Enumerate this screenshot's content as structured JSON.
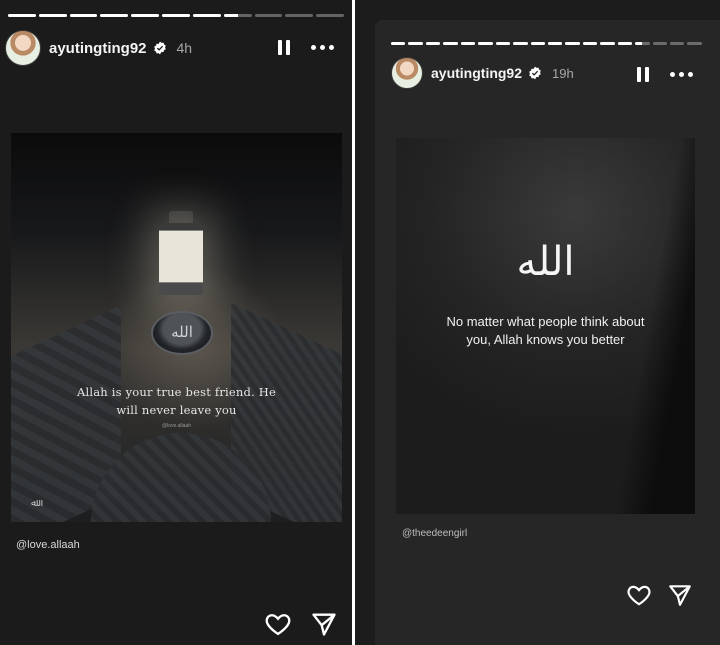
{
  "left_story": {
    "progress": {
      "segments": 11,
      "completed": 7,
      "current_fraction": 0.5
    },
    "username": "ayutingting92",
    "time": "4h",
    "media": {
      "medallion_text": "الله",
      "quote_line1": "Allah is your true best friend. He",
      "quote_line2": "will never leave you",
      "credit": "@love.allaah",
      "signature": "ﷲ"
    },
    "tag": "@love.allaah",
    "icons": [
      "heart-icon",
      "send-icon",
      "pause-icon",
      "more-icon",
      "verified-icon"
    ]
  },
  "right_story": {
    "progress": {
      "segments": 18,
      "completed": 14,
      "current_fraction": 0.5
    },
    "username": "ayutingting92",
    "time": "19h",
    "media": {
      "title": "الله",
      "quote_line1": "No matter what people think about",
      "quote_line2": "you, Allah knows you better"
    },
    "tag": "@theedeengirl",
    "icons": [
      "heart-icon",
      "send-icon",
      "pause-icon",
      "more-icon",
      "verified-icon"
    ]
  },
  "colors": {
    "background": "#1b1b1b",
    "verified": "#ffffff",
    "text_muted": "#a8a8a8"
  }
}
